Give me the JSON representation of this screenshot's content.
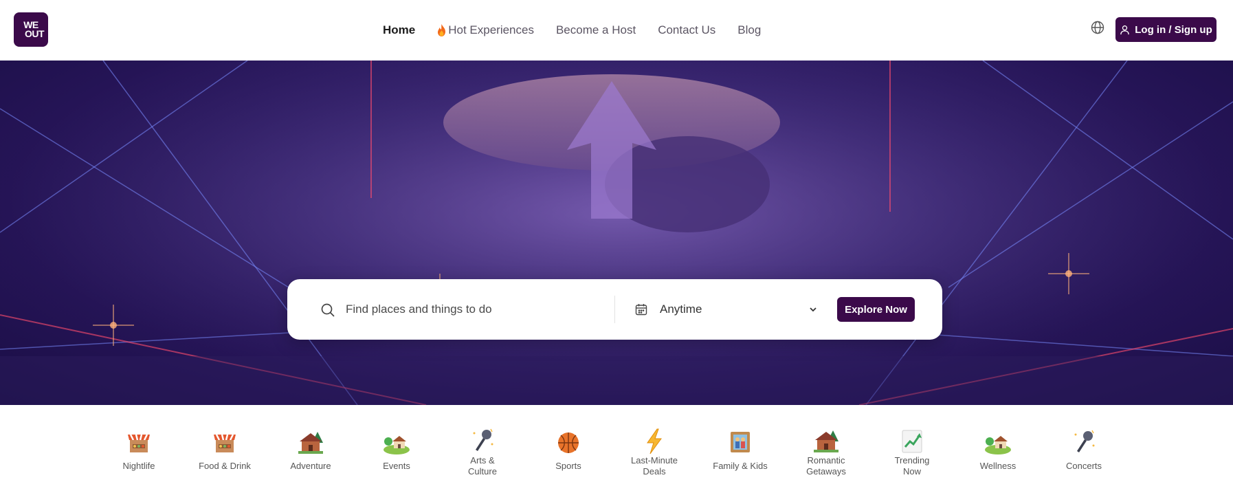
{
  "brand": {
    "logo_line1": "WE",
    "logo_line2": "OUT"
  },
  "nav": {
    "items": [
      {
        "label": "Home",
        "active": true
      },
      {
        "label": "Hot Experiences",
        "icon": "fire-icon"
      },
      {
        "label": "Become a Host"
      },
      {
        "label": "Contact Us"
      },
      {
        "label": "Blog"
      }
    ]
  },
  "header": {
    "language_icon": "globe-icon",
    "login_label": "Log in / Sign up"
  },
  "search": {
    "placeholder": "Find places and things to do",
    "value": "",
    "date_value": "Anytime",
    "explore_label": "Explore Now"
  },
  "categories": [
    {
      "label": "Nightlife",
      "icon": "market-stall-icon"
    },
    {
      "label": "Food & Drink",
      "icon": "market-stall-icon"
    },
    {
      "label": "Adventure",
      "icon": "cabin-icon"
    },
    {
      "label": "Events",
      "icon": "park-house-icon"
    },
    {
      "label": "Arts & Culture",
      "line1": "Arts &",
      "line2": "Culture",
      "icon": "microphone-icon"
    },
    {
      "label": "Sports",
      "icon": "basketball-icon"
    },
    {
      "label": "Last-Minute Deals",
      "line1": "Last-Minute",
      "line2": "Deals",
      "icon": "lightning-icon"
    },
    {
      "label": "Family & Kids",
      "icon": "family-portrait-icon"
    },
    {
      "label": "Romantic Getaways",
      "line1": "Romantic",
      "line2": "Getaways",
      "icon": "cabin-icon"
    },
    {
      "label": "Trending Now",
      "line1": "Trending",
      "line2": "Now",
      "icon": "trending-chart-icon"
    },
    {
      "label": "Wellness",
      "icon": "park-house-icon"
    },
    {
      "label": "Concerts",
      "icon": "microphone-icon"
    }
  ],
  "colors": {
    "brand": "#3b0a4a",
    "hero_base": "#2b1a63"
  }
}
